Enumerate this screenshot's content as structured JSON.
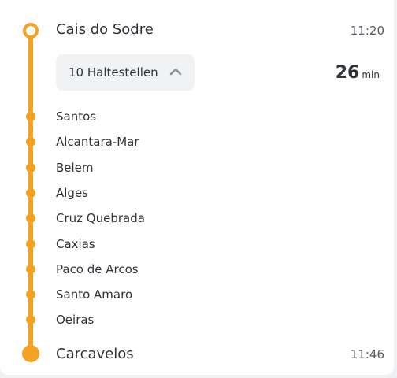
{
  "route": {
    "origin": {
      "name": "Cais do Sodre",
      "time": "11:20"
    },
    "destination": {
      "name": "Carcavelos",
      "time": "11:46"
    },
    "stops_toggle": {
      "label": "10 Haltestellen",
      "icon": "chevron-up-icon"
    },
    "duration": {
      "value": "26",
      "unit": "min"
    },
    "intermediate_stops": [
      "Santos",
      "Alcantara-Mar",
      "Belem",
      "Alges",
      "Cruz Quebrada",
      "Caxias",
      "Paco de Arcos",
      "Santo Amaro",
      "Oeiras"
    ]
  },
  "colors": {
    "line": "#f4a224",
    "text": "#2f3338",
    "toggle_bg": "#f1f2f4"
  }
}
